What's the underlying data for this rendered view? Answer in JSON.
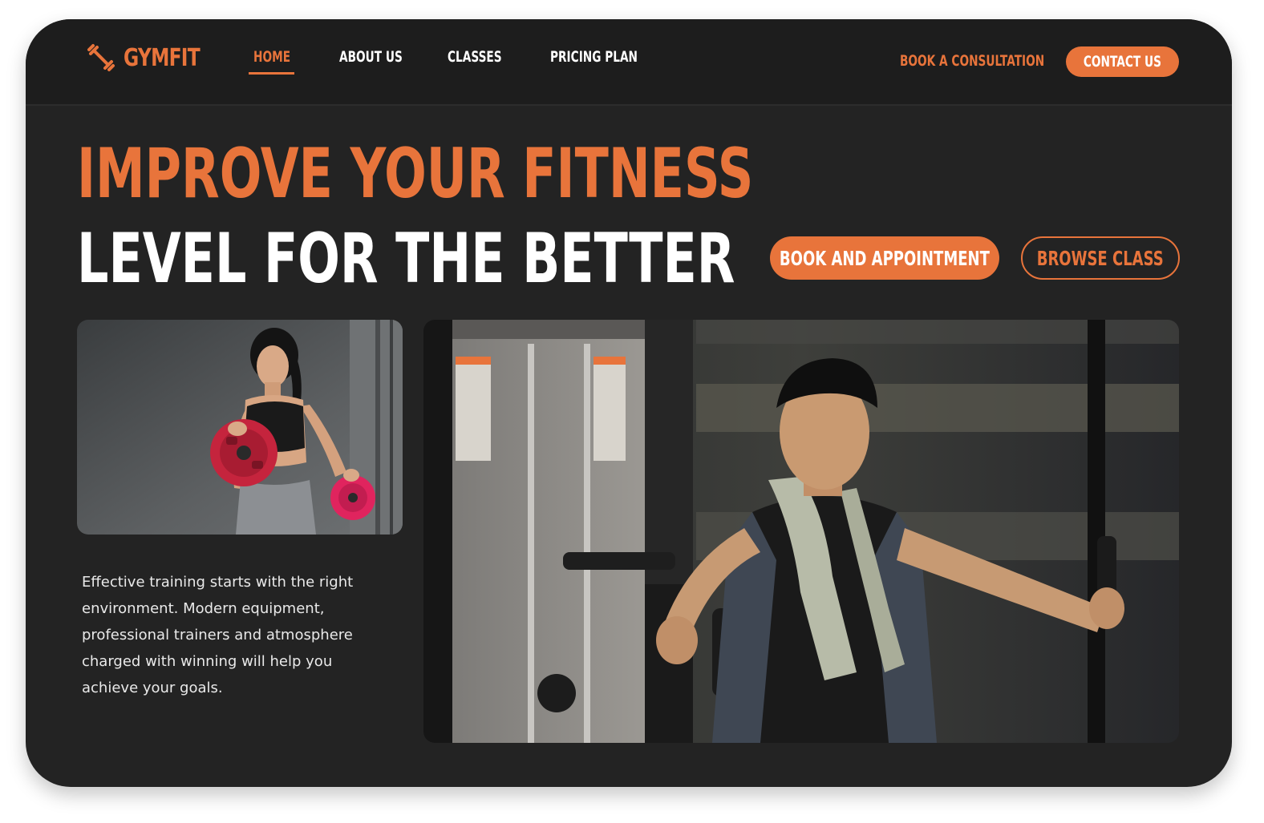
{
  "brand": {
    "name": "GYMFIT",
    "accent_color": "#e8743b",
    "background_color": "#232323",
    "logo_icon": "dumbbell-icon"
  },
  "nav": {
    "links": [
      {
        "label": "HOME",
        "active": true
      },
      {
        "label": "ABOUT US",
        "active": false
      },
      {
        "label": "CLASSES",
        "active": false
      },
      {
        "label": "PRICING PLAN",
        "active": false
      }
    ],
    "consultation_label": "BOOK A CONSULTATION",
    "contact_label": "CONTACT US"
  },
  "hero": {
    "headline_line1": "IMPROVE YOUR FITNESS",
    "headline_line2": "LEVEL FOR THE BETTER",
    "primary_button": "BOOK AND APPOINTMENT",
    "secondary_button": "BROWSE CLASS",
    "description": "Effective training starts with the right environment. Modern equipment, professional trainers and atmosphere charged with winning will help you achieve your goals."
  },
  "images": {
    "woman_photo": "woman-lifting-weight-plates-photo",
    "man_photo": "man-using-chest-fly-machine-photo"
  }
}
